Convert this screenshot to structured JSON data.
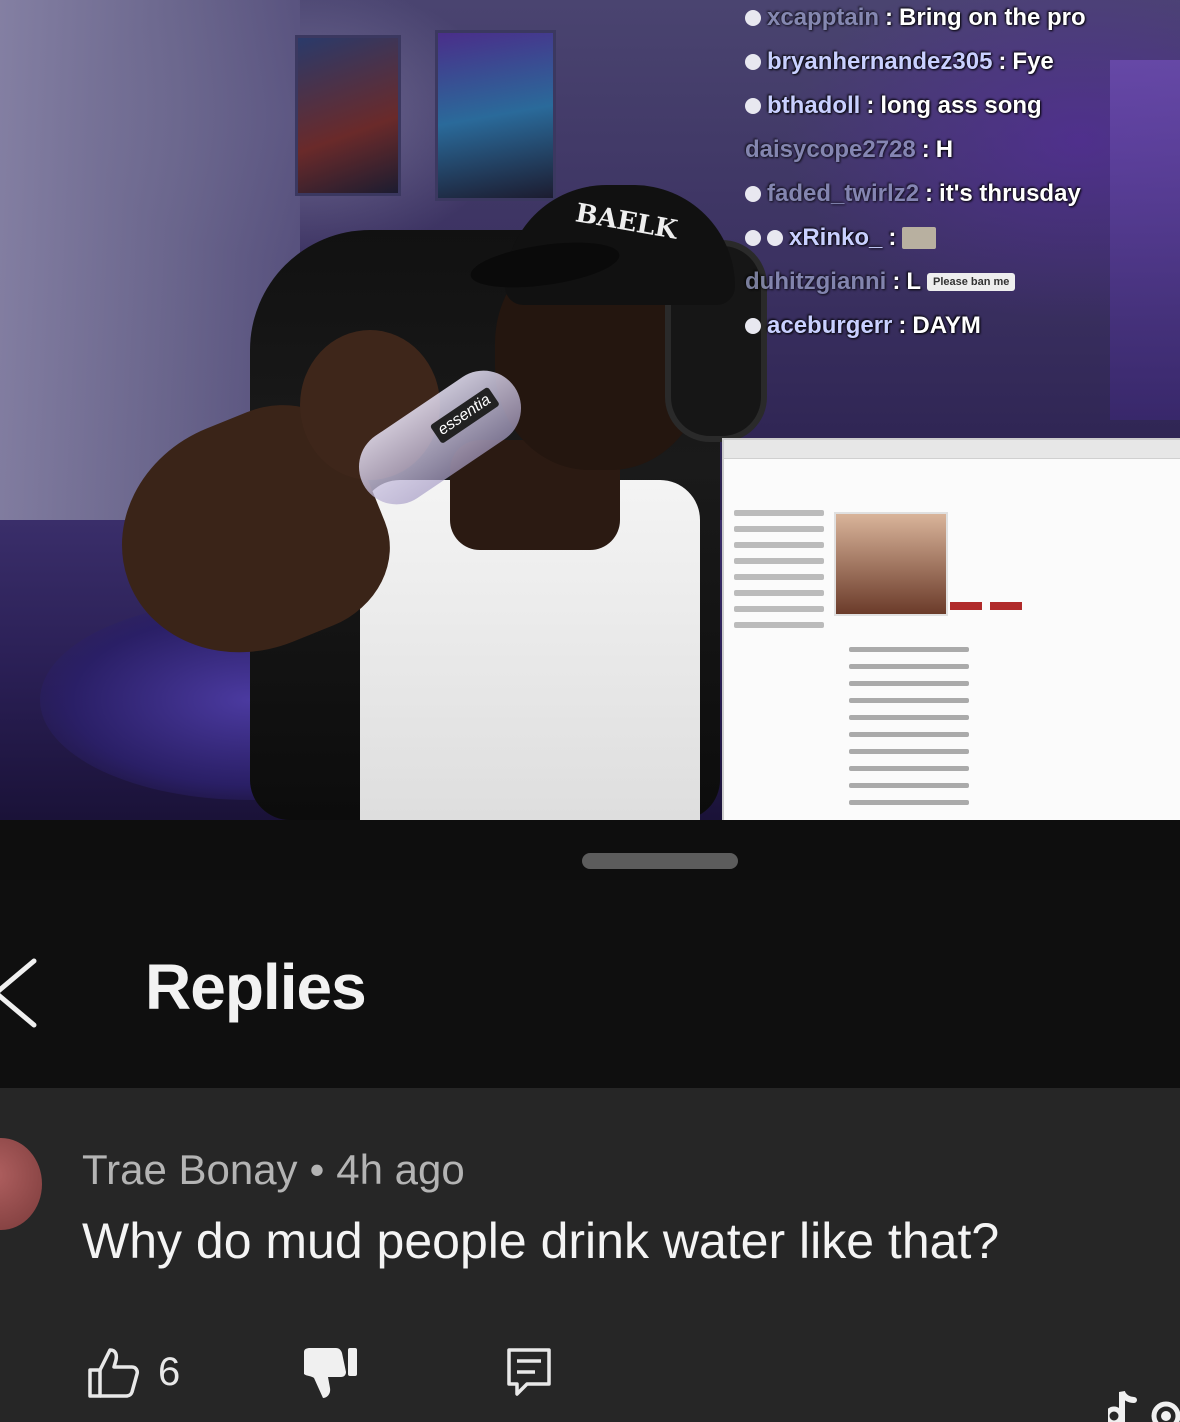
{
  "stream_chat": [
    {
      "user": "xcapptain",
      "text": "Bring on the pro",
      "dim": true
    },
    {
      "user": "bryanhernandez305",
      "text": "Fye",
      "dim": false
    },
    {
      "user": "bthadoll",
      "text": "long ass song",
      "dim": false
    },
    {
      "user": "daisycope2728",
      "text": "H",
      "dim": true
    },
    {
      "user": "faded_twirlz2",
      "text": "it's thrusday",
      "dim": true
    },
    {
      "user": "xRinko_",
      "text": "",
      "dim": false
    },
    {
      "user": "duhitzgianni",
      "text": "L",
      "tag": "Please ban me",
      "dim": true
    },
    {
      "user": "aceburgerr",
      "text": "DAYM",
      "dim": false
    }
  ],
  "cap_text": "BAELK",
  "bottle_label": "essentia",
  "sheet": {
    "title": "Replies"
  },
  "comment": {
    "author": "Trae Bonay",
    "separator": "•",
    "time": "4h ago",
    "text": "Why do mud people drink water like that?",
    "like_count": "6"
  },
  "icons": {
    "back": "chevron-left-icon",
    "like": "thumbs-up-icon",
    "dislike": "thumbs-down-icon",
    "reply": "comment-icon",
    "watermark": "tiktok-logo-icon"
  },
  "colors": {
    "sheet_bg": "#0e0e0e",
    "comment_bg": "#262626",
    "text_primary": "#f4f4f4",
    "text_secondary": "#b4b4b4"
  }
}
